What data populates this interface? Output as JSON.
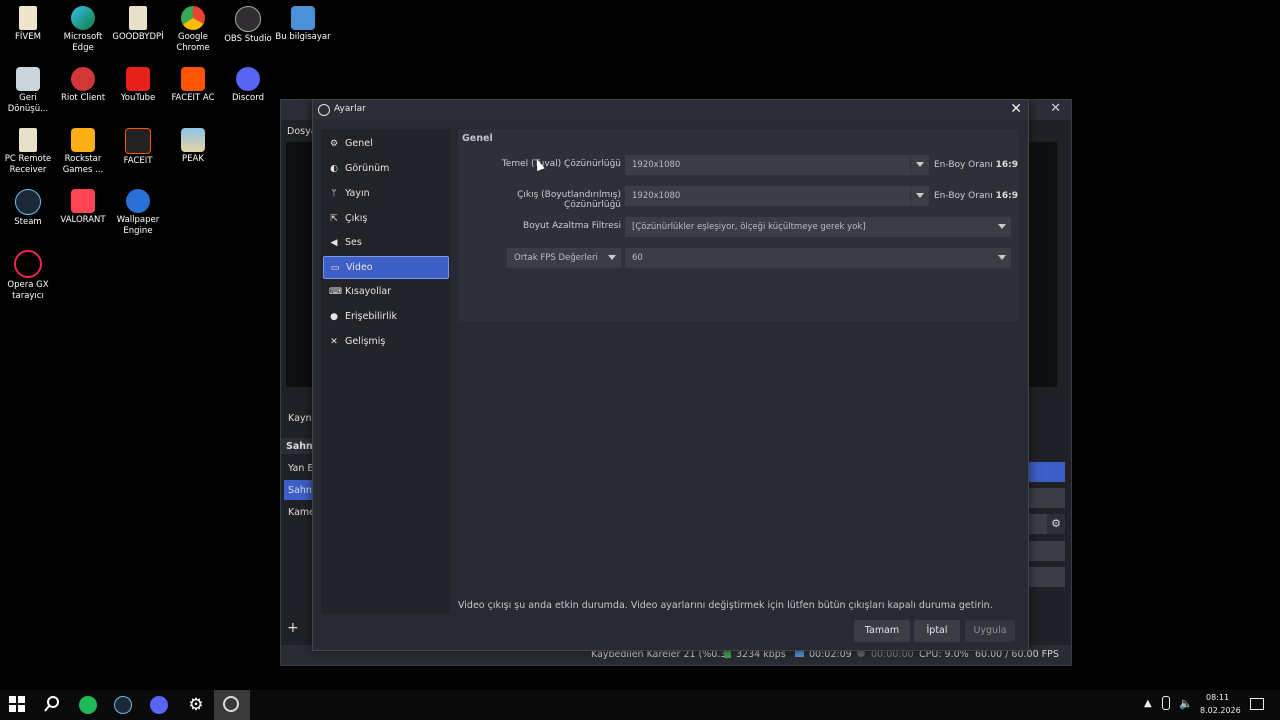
{
  "desktop": {
    "icons": [
      {
        "label": "FİVEM"
      },
      {
        "label": "Microsoft Edge"
      },
      {
        "label": "GOODBYDPİ"
      },
      {
        "label": "Google Chrome"
      },
      {
        "label": "OBS Studio"
      },
      {
        "label": "Bu bilgisayar"
      },
      {
        "label": "Geri Dönüşü..."
      },
      {
        "label": "Riot Client"
      },
      {
        "label": "YouTube"
      },
      {
        "label": "FACEIT AC"
      },
      {
        "label": "Discord"
      },
      {
        "label": "PC Remote Receiver"
      },
      {
        "label": "Rockstar Games ..."
      },
      {
        "label": "FACEIT"
      },
      {
        "label": "PEAK"
      },
      {
        "label": "Steam"
      },
      {
        "label": "VALORANT"
      },
      {
        "label": "Wallpaper Engine"
      },
      {
        "label": "Opera GX tarayıcı"
      }
    ]
  },
  "obs_main": {
    "menu_partial": "Dosya",
    "sources_partial": "Kayna",
    "scenes_partial": "Sahn",
    "scene_items": [
      "Yan E",
      "Sahne",
      "Kame"
    ],
    "status": {
      "dropped": "Kaybedilen Kareler 21 (%0.3)",
      "bitrate": "3234 kbps",
      "stream_time": "00:02:09",
      "rec_time": "00:00:00",
      "cpu": "CPU: 9.0%",
      "fps": "60.00 / 60.00 FPS"
    }
  },
  "dialog": {
    "title": "Ayarlar",
    "nav": [
      {
        "label": "Genel",
        "icon": "gear-icon"
      },
      {
        "label": "Görünüm",
        "icon": "palette-icon"
      },
      {
        "label": "Yayın",
        "icon": "antenna-icon"
      },
      {
        "label": "Çıkış",
        "icon": "output-icon"
      },
      {
        "label": "Ses",
        "icon": "speaker-icon"
      },
      {
        "label": "Video",
        "icon": "monitor-icon"
      },
      {
        "label": "Kısayollar",
        "icon": "keyboard-icon"
      },
      {
        "label": "Erişebilirlik",
        "icon": "accessibility-icon"
      },
      {
        "label": "Gelişmiş",
        "icon": "wrench-icon"
      }
    ],
    "active_nav": "Video",
    "section": "Genel",
    "base_res_label": "Temel (Tuval) Çözünürlüğü",
    "base_res_value": "1920x1080",
    "output_res_label": "Çıkış (Boyutlandırılmış) Çözünürlüğü",
    "output_res_value": "1920x1080",
    "aspect_label": "En-Boy Oranı",
    "aspect_value": "16:9",
    "filter_label": "Boyut Azaltma Filtresi",
    "filter_value": "[Çözünürlükler eşleşiyor, ölçeği küçültmeye gerek yok]",
    "fps_type": "Ortak FPS Değerleri",
    "fps_value": "60",
    "note": "Video çıkışı şu anda etkin durumda. Video ayarlarını değiştirmek için lütfen bütün çıkışları kapalı duruma getirin.",
    "buttons": {
      "ok": "Tamam",
      "cancel": "İptal",
      "apply": "Uygula"
    }
  },
  "taskbar": {
    "time": "08:11",
    "date": "8.02.2026"
  }
}
